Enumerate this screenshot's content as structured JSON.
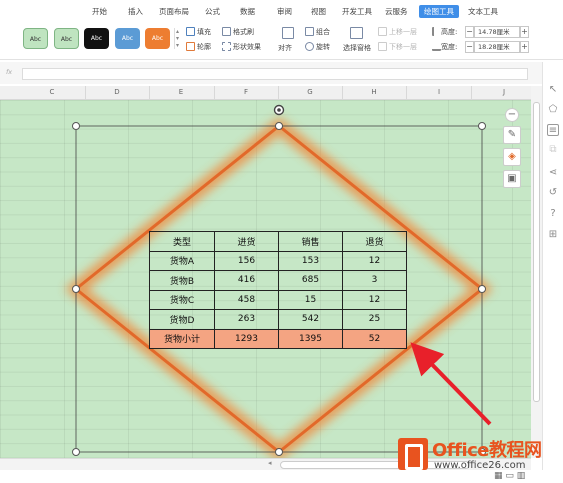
{
  "menu": {
    "tabs": [
      "开始",
      "插入",
      "页面布局",
      "公式",
      "数据",
      "审阅",
      "视图",
      "开发工具",
      "云服务",
      "绘图工具",
      "文本工具"
    ],
    "active": "绘图工具"
  },
  "ribbon": {
    "styles": [
      "Abc",
      "Abc",
      "Abc",
      "Abc",
      "Abc"
    ],
    "style_colors": [
      "#bfe4c0",
      "#bfe4c0",
      "#1a1a1a",
      "#5b9bd5",
      "#ed7d31"
    ],
    "fill_label": "填充",
    "format_painter_label": "格式刷",
    "outline_label": "轮廓",
    "shape_effect_label": "形状效果",
    "align_label": "对齐",
    "group_label": "组合",
    "rotate_label": "旋转",
    "selection_pane_label": "选择窗格",
    "bring_forward_label": "上移一层",
    "send_backward_label": "下移一层",
    "height_label": "高度:",
    "height_value": "14.78厘米",
    "width_label": "宽度:",
    "width_value": "18.28厘米"
  },
  "formula_bar": {
    "fx": "fx",
    "value": ""
  },
  "columns": [
    "C",
    "D",
    "E",
    "F",
    "G",
    "H",
    "I",
    "J"
  ],
  "table": {
    "header": [
      "类型",
      "进货",
      "销售",
      "退货"
    ],
    "rows": [
      [
        "货物A",
        "156",
        "153",
        "12"
      ],
      [
        "货物B",
        "416",
        "685",
        "3"
      ],
      [
        "货物C",
        "458",
        "15",
        "12"
      ],
      [
        "货物D",
        "263",
        "542",
        "25"
      ]
    ],
    "total": [
      "货物小计",
      "1293",
      "1395",
      "52"
    ]
  },
  "colors": {
    "sheet_bg": "#c6e7c6",
    "glow": "#f08a3c",
    "total_row": "#f4a482",
    "arrow": "#e8202a",
    "brand": "#e8531f",
    "active_tab": "#3f8ee8"
  },
  "logo": {
    "title": "Office教程网",
    "url": "www.office26.com"
  }
}
